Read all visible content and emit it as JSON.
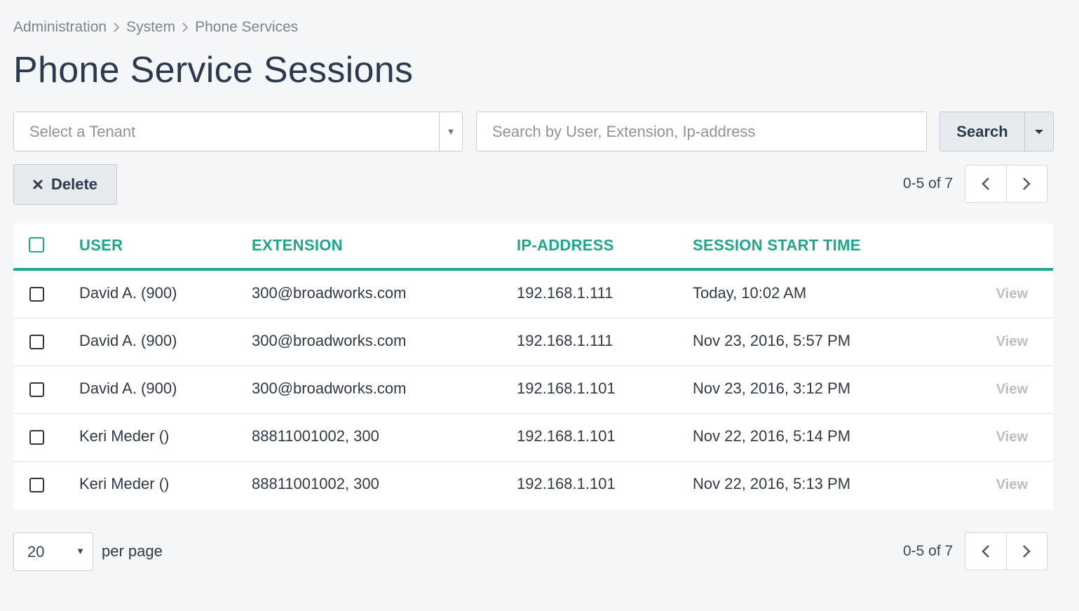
{
  "breadcrumb": {
    "items": [
      "Administration",
      "System",
      "Phone Services"
    ]
  },
  "page": {
    "title": "Phone Service Sessions"
  },
  "filters": {
    "tenant_placeholder": "Select a Tenant",
    "search_placeholder": "Search by User, Extension, Ip-address",
    "search_label": "Search"
  },
  "toolbar": {
    "delete_label": "Delete"
  },
  "pagination": {
    "range_text": "0-5 of 7"
  },
  "table": {
    "columns": [
      "USER",
      "EXTENSION",
      "IP-ADDRESS",
      "SESSION START TIME"
    ],
    "view_label": "View",
    "rows": [
      {
        "user": "David A. (900)",
        "extension": "300@broadworks.com",
        "ip": "192.168.1.111",
        "start": "Today, 10:02 AM"
      },
      {
        "user": "David A. (900)",
        "extension": "300@broadworks.com",
        "ip": "192.168.1.111",
        "start": "Nov 23, 2016, 5:57 PM"
      },
      {
        "user": "David A. (900)",
        "extension": "300@broadworks.com",
        "ip": "192.168.1.101",
        "start": "Nov 23, 2016, 3:12 PM"
      },
      {
        "user": "Keri Meder ()",
        "extension": "88811001002, 300",
        "ip": "192.168.1.101",
        "start": "Nov 22, 2016, 5:14 PM"
      },
      {
        "user": "Keri Meder ()",
        "extension": "88811001002, 300",
        "ip": "192.168.1.101",
        "start": "Nov 22, 2016, 5:13 PM"
      }
    ]
  },
  "footer": {
    "per_page_value": "20",
    "per_page_label": "per page"
  },
  "colors": {
    "accent": "#1fa688",
    "title": "#2b3a4f",
    "background": "#f5f6f8"
  }
}
